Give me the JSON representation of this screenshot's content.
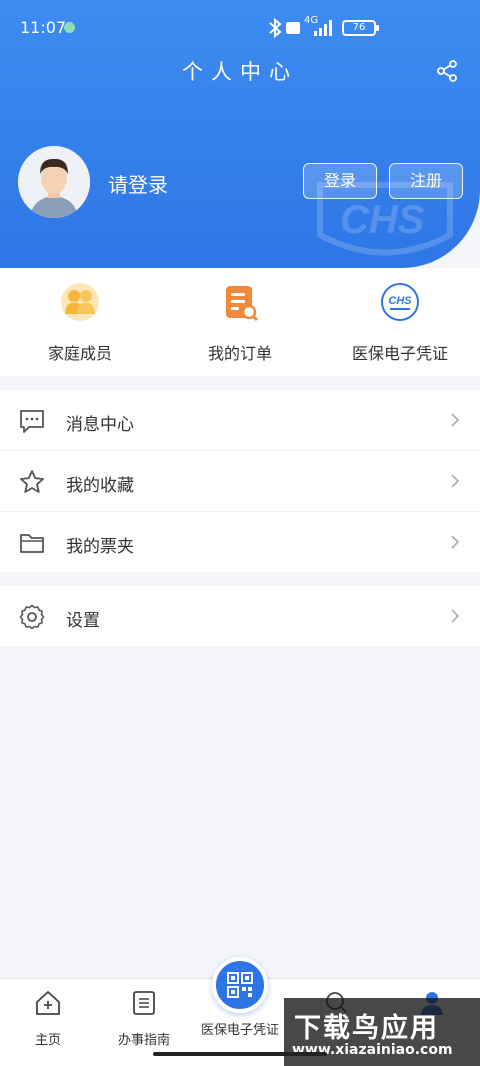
{
  "status_bar": {
    "time": "11:07",
    "network": "4G",
    "battery": "76"
  },
  "header": {
    "title": "个人中心",
    "login_prompt": "请登录",
    "login_button": "登录",
    "register_button": "注册",
    "watermark": "CHS"
  },
  "quick_entries": [
    {
      "label": "家庭成员",
      "icon": "family-icon"
    },
    {
      "label": "我的订单",
      "icon": "order-icon"
    },
    {
      "label": "医保电子凭证",
      "icon": "chs-icon",
      "badge_text": "CHS"
    }
  ],
  "menu": [
    {
      "label": "消息中心",
      "icon": "message-icon"
    },
    {
      "label": "我的收藏",
      "icon": "star-icon"
    },
    {
      "label": "我的票夹",
      "icon": "folder-icon"
    }
  ],
  "settings": {
    "label": "设置",
    "icon": "gear-icon"
  },
  "tabs": [
    {
      "label": "主页",
      "icon": "home-icon"
    },
    {
      "label": "办事指南",
      "icon": "guide-icon"
    },
    {
      "label": "医保电子凭证",
      "icon": "qr-icon"
    },
    {
      "label": "",
      "icon": "search-icon"
    },
    {
      "label": "",
      "icon": "profile-icon"
    }
  ],
  "watermark": {
    "title": "下载鸟应用",
    "url": "www.xiazainiao.com"
  },
  "colors": {
    "primary": "#2f76e6",
    "accent_orange": "#f08a3a",
    "accent_yellow": "#f6b63c"
  }
}
